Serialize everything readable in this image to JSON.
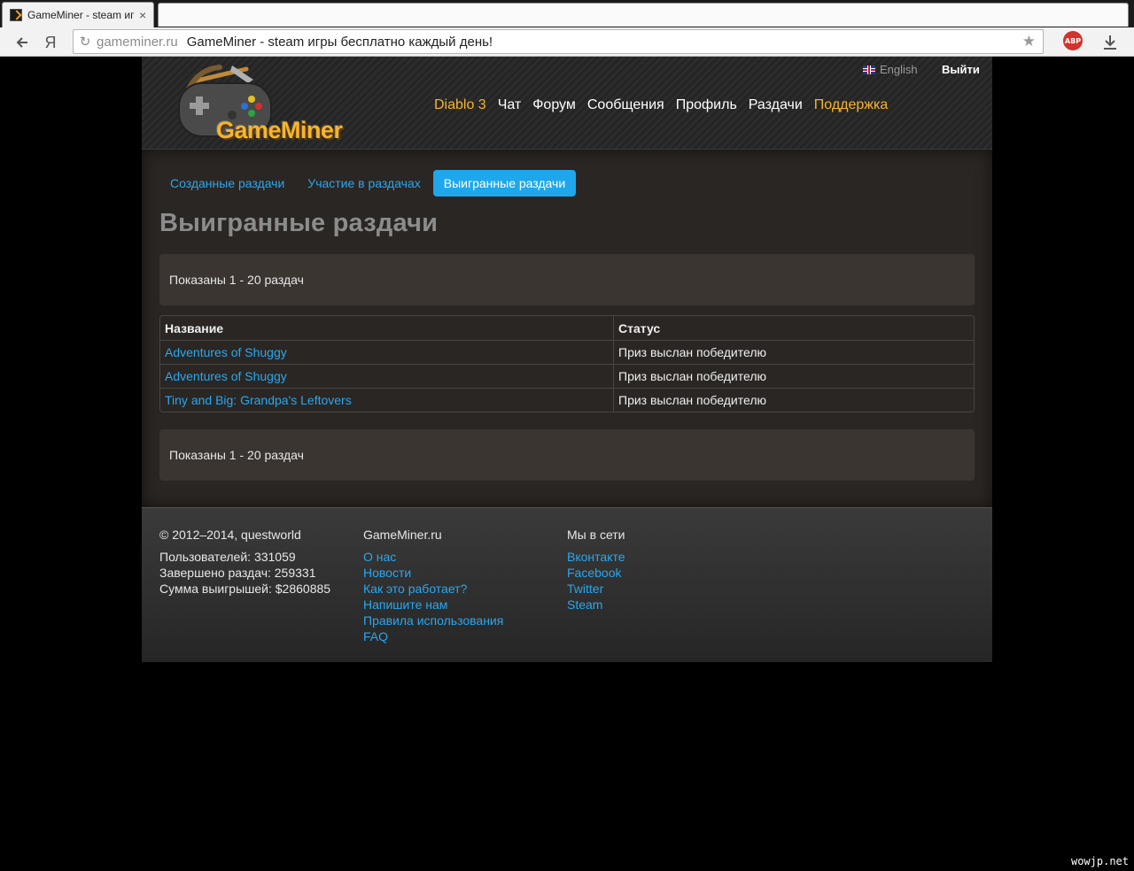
{
  "browser": {
    "tab_title": "GameMiner - steam иг",
    "tab_close": "×",
    "url_domain": "gameminer.ru",
    "url_title": "GameMiner - steam игры бесплатно каждый день!",
    "abp_label": "ABP",
    "yandex_label": "Я"
  },
  "header": {
    "lang_label": "English",
    "logout_label": "Выйти",
    "logo_text": "GameMiner",
    "nav": [
      {
        "label": "Diablo 3",
        "highlight": true
      },
      {
        "label": "Чат",
        "highlight": false
      },
      {
        "label": "Форум",
        "highlight": false
      },
      {
        "label": "Сообщения",
        "highlight": false
      },
      {
        "label": "Профиль",
        "highlight": false
      },
      {
        "label": "Раздачи",
        "highlight": false
      },
      {
        "label": "Поддержка",
        "highlight": true
      }
    ]
  },
  "subtabs": [
    {
      "label": "Созданные раздачи",
      "active": false
    },
    {
      "label": "Участие в раздачах",
      "active": false
    },
    {
      "label": "Выигранные раздачи",
      "active": true
    }
  ],
  "page_title": "Выигранные раздачи",
  "pager_text": "Показаны 1 - 20 раздач",
  "table": {
    "headers": [
      "Название",
      "Статус"
    ],
    "rows": [
      {
        "name": "Adventures of Shuggy",
        "status": "Приз выслан победителю"
      },
      {
        "name": "Adventures of Shuggy",
        "status": "Приз выслан победителю"
      },
      {
        "name": "Tiny and Big: Grandpa's Leftovers",
        "status": "Приз выслан победителю"
      }
    ]
  },
  "footer": {
    "copyright": "© 2012–2014, questworld",
    "stats": [
      "Пользователей: 331059",
      "Завершено раздач: 259331",
      "Сумма выигрышей: $2860885"
    ],
    "site_head": "GameMiner.ru",
    "site_links": [
      "О нас",
      "Новости",
      "Как это работает?",
      "Напишите нам",
      "Правила использования",
      "FAQ"
    ],
    "social_head": "Мы в сети",
    "social_links": [
      "Вконтакте",
      "Facebook",
      "Twitter",
      "Steam"
    ]
  },
  "watermark": "wowjp.net",
  "colors": {
    "accent_blue": "#2aa7ee",
    "accent_orange": "#f6b52c",
    "active_tab": "#1ea7ec"
  }
}
